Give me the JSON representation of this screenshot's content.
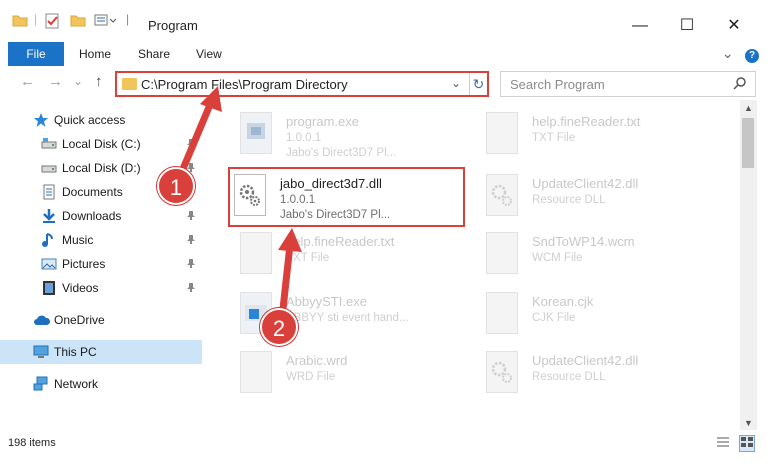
{
  "window": {
    "title": "Program",
    "minimize_glyph": "—",
    "maximize_glyph": "☐",
    "close_glyph": "✕"
  },
  "ribbon": {
    "tabs": [
      "File",
      "Home",
      "Share",
      "View"
    ],
    "expand_glyph": "⌄",
    "help_glyph": "?"
  },
  "navigation": {
    "back_glyph": "←",
    "forward_glyph": "→",
    "recent_glyph": "⌄",
    "up_glyph": "↑"
  },
  "address": {
    "path": "C:\\Program Files\\Program Directory",
    "dropdown_glyph": "⌄",
    "refresh_glyph": "↻"
  },
  "search": {
    "placeholder": "Search Program"
  },
  "sidebar": {
    "items": [
      {
        "label": "Quick access",
        "icon": "star-icon",
        "pinned": false
      },
      {
        "label": "Local Disk (C:)",
        "icon": "disk-icon",
        "pinned": true
      },
      {
        "label": "Local Disk (D:)",
        "icon": "disk-icon",
        "pinned": true
      },
      {
        "label": "Documents",
        "icon": "documents-icon",
        "pinned": true
      },
      {
        "label": "Downloads",
        "icon": "downloads-icon",
        "pinned": true
      },
      {
        "label": "Music",
        "icon": "music-icon",
        "pinned": true
      },
      {
        "label": "Pictures",
        "icon": "pictures-icon",
        "pinned": true
      },
      {
        "label": "Videos",
        "icon": "videos-icon",
        "pinned": true
      },
      {
        "label": "OneDrive",
        "icon": "cloud-icon",
        "pinned": false
      },
      {
        "label": "This PC",
        "icon": "computer-icon",
        "pinned": false,
        "selected": true
      },
      {
        "label": "Network",
        "icon": "network-icon",
        "pinned": false
      }
    ],
    "pin_glyph": "📌"
  },
  "files": [
    {
      "name": "program.exe",
      "line1": "1.0.0.1",
      "line2": "Jabo's Direct3D7 Pl...",
      "icon": "exe-icon"
    },
    {
      "name": "help.fineReader.txt",
      "line1": "TXT File",
      "line2": "",
      "icon": "text-file-icon"
    },
    {
      "name": "jabo_direct3d7.dll",
      "line1": "1.0.0.1",
      "line2": "Jabo's Direct3D7 Pl...",
      "icon": "dll-gear-icon",
      "highlight": true
    },
    {
      "name": "UpdateClient42.dll",
      "line1": "Resource DLL",
      "line2": "",
      "icon": "dll-gear-icon"
    },
    {
      "name": "help.fineReader.txt",
      "line1": "TXT File",
      "line2": "",
      "icon": "text-file-icon"
    },
    {
      "name": "SndToWP14.wcm",
      "line1": "WCM File",
      "line2": "",
      "icon": "file-icon"
    },
    {
      "name": "AbbyySTI.exe",
      "line1": "ABBYY sti event hand...",
      "line2": "",
      "icon": "exe-icon"
    },
    {
      "name": "Korean.cjk",
      "line1": "CJK File",
      "line2": "",
      "icon": "file-icon"
    },
    {
      "name": "Arabic.wrd",
      "line1": "WRD File",
      "line2": "",
      "icon": "file-icon"
    },
    {
      "name": "UpdateClient42.dll",
      "line1": "Resource DLL",
      "line2": "",
      "icon": "dll-gear-icon"
    }
  ],
  "status": {
    "item_count": "198 items"
  },
  "annotations": {
    "step1": "1",
    "step2": "2",
    "color": "#d9403b"
  }
}
